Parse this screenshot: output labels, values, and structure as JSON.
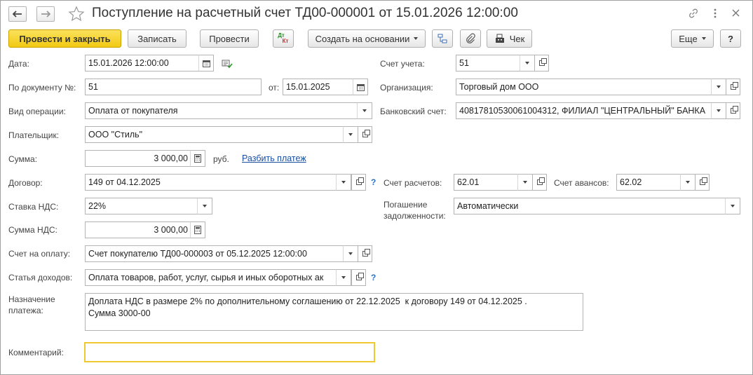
{
  "header": {
    "title": "Поступление на расчетный счет ТД00-000001 от 15.01.2026 12:00:00"
  },
  "toolbar": {
    "post_close": "Провести и закрыть",
    "save": "Записать",
    "post": "Провести",
    "dtkt_top": "Дт",
    "dtkt_bottom": "Кт",
    "create_based": "Создать на основании",
    "receipt": "Чек",
    "more": "Еще",
    "help": "?"
  },
  "form": {
    "date_label": "Дата:",
    "date_value": "15.01.2026 12:00:00",
    "doc_number_label": "По документу №:",
    "doc_number_value": "51",
    "doc_date_label": "от:",
    "doc_date_value": "15.01.2025",
    "operation_label": "Вид операции:",
    "operation_value": "Оплата от покупателя",
    "payer_label": "Плательщик:",
    "payer_value": "ООО \"Стиль\"",
    "amount_label": "Сумма:",
    "amount_value": "3 000,00",
    "currency": "руб.",
    "split_link": "Разбить платеж",
    "contract_label": "Договор:",
    "contract_value": "149 от 04.12.2025",
    "vat_rate_label": "Ставка НДС:",
    "vat_rate_value": "22%",
    "vat_amount_label": "Сумма НДС:",
    "vat_amount_value": "3 000,00",
    "invoice_label": "Счет на оплату:",
    "invoice_value": "Счет покупателю ТД00-000003 от 05.12.2025 12:00:00",
    "income_item_label": "Статья доходов:",
    "income_item_value": "Оплата товаров, работ, услуг, сырья и иных оборотных ак",
    "purpose_label": "Назначение платежа:",
    "purpose_value": "Доплата НДС в размере 2% по дополнительному соглашению от 22.12.2025  к договору 149 от 04.12.2025 .\nСумма 3000-00",
    "comment_label": "Комментарий:",
    "comment_value": "",
    "account_label": "Счет учета:",
    "account_value": "51",
    "organization_label": "Организация:",
    "organization_value": "Торговый дом ООО",
    "bank_account_label": "Банковский счет:",
    "bank_account_value": "40817810530061004312, ФИЛИАЛ \"ЦЕНТРАЛЬНЫЙ\" БАНКА",
    "settlement_account_label": "Счет расчетов:",
    "settlement_account_value": "62.01",
    "advance_account_label": "Счет авансов:",
    "advance_account_value": "62.02",
    "debt_repayment_label": "Погашение задолженности:",
    "debt_repayment_value": "Автоматически",
    "question": "?"
  }
}
